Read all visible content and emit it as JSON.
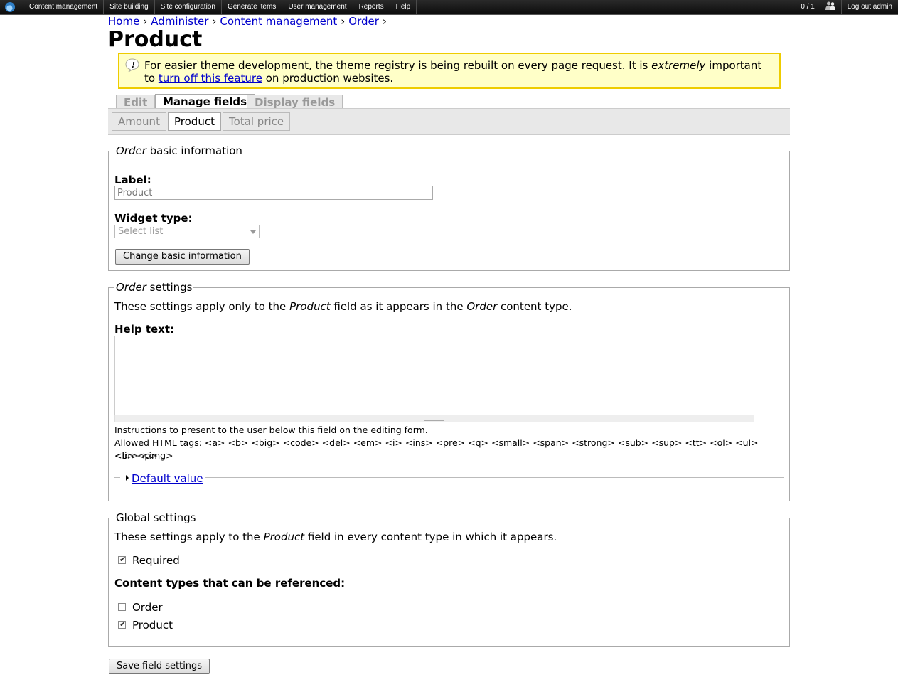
{
  "admin_menu": {
    "items": [
      "Content management",
      "Site building",
      "Site configuration",
      "Generate items",
      "User management",
      "Reports",
      "Help"
    ],
    "users_count": "0 / 1",
    "logout": "Log out admin"
  },
  "breadcrumb": [
    "Home",
    "Administer",
    "Content management",
    "Order"
  ],
  "breadcrumb_separator": "›",
  "page_title": "Product",
  "warning": {
    "text_1": "For easier theme development, the theme registry is being rebuilt on every page request. It is ",
    "text_em": "extremely",
    "text_2": " important to ",
    "link": "turn off this feature",
    "text_3": " on production websites."
  },
  "tabs": [
    "Edit",
    "Manage fields",
    "Display fields"
  ],
  "active_tab": "Manage fields",
  "subtabs": [
    "Amount",
    "Product",
    "Total price"
  ],
  "active_subtab": "Product",
  "basic_info": {
    "legend_em": "Order",
    "legend_rest": " basic information",
    "label_label": "Label:",
    "label_value": "Product",
    "widget_label": "Widget type:",
    "widget_value": "Select list",
    "button": "Change basic information"
  },
  "order_settings": {
    "legend_em": "Order",
    "legend_rest": " settings",
    "desc_1": "These settings apply only to the ",
    "desc_em1": "Product",
    "desc_2": " field as it appears in the ",
    "desc_em2": "Order",
    "desc_3": " content type.",
    "help_label": "Help text:",
    "help_value": "",
    "instructions": "Instructions to present to the user below this field on the editing form.",
    "allowed_html_1": "Allowed HTML tags: <a> <b> <big> <code> <del> <em> <i> <ins> <pre> <q> <small> <span> <strong> <sub> <sup> <tt> <ol> <ul> <li> <p>",
    "allowed_html_2": "<br> <img>",
    "default_value": "Default value"
  },
  "global_settings": {
    "legend": "Global settings",
    "desc_1": "These settings apply to the ",
    "desc_em": "Product",
    "desc_2": " field in every content type in which it appears.",
    "required_label": "Required",
    "required_checked": true,
    "content_types_label": "Content types that can be referenced:",
    "content_types": [
      {
        "label": "Order",
        "checked": false
      },
      {
        "label": "Product",
        "checked": true
      }
    ]
  },
  "save_button": "Save field settings"
}
